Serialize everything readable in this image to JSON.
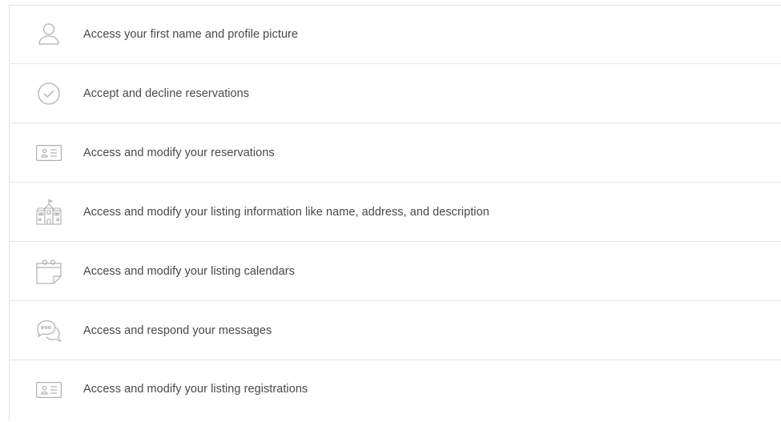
{
  "permissions": {
    "items": [
      {
        "label": "Access your first name and profile picture",
        "icon": "user-icon"
      },
      {
        "label": "Accept and decline reservations",
        "icon": "check-circle-icon"
      },
      {
        "label": "Access and modify your reservations",
        "icon": "id-card-icon"
      },
      {
        "label": "Access and modify your listing information like name, address, and description",
        "icon": "listing-building-icon"
      },
      {
        "label": "Access and modify your listing calendars",
        "icon": "calendar-icon"
      },
      {
        "label": "Access and respond your messages",
        "icon": "chat-bubble-icon"
      },
      {
        "label": "Access and modify your listing registrations",
        "icon": "id-card-icon"
      }
    ]
  },
  "colors": {
    "text": "#484848",
    "icon": "#b0b0b0",
    "divider": "#e4e4e4"
  }
}
